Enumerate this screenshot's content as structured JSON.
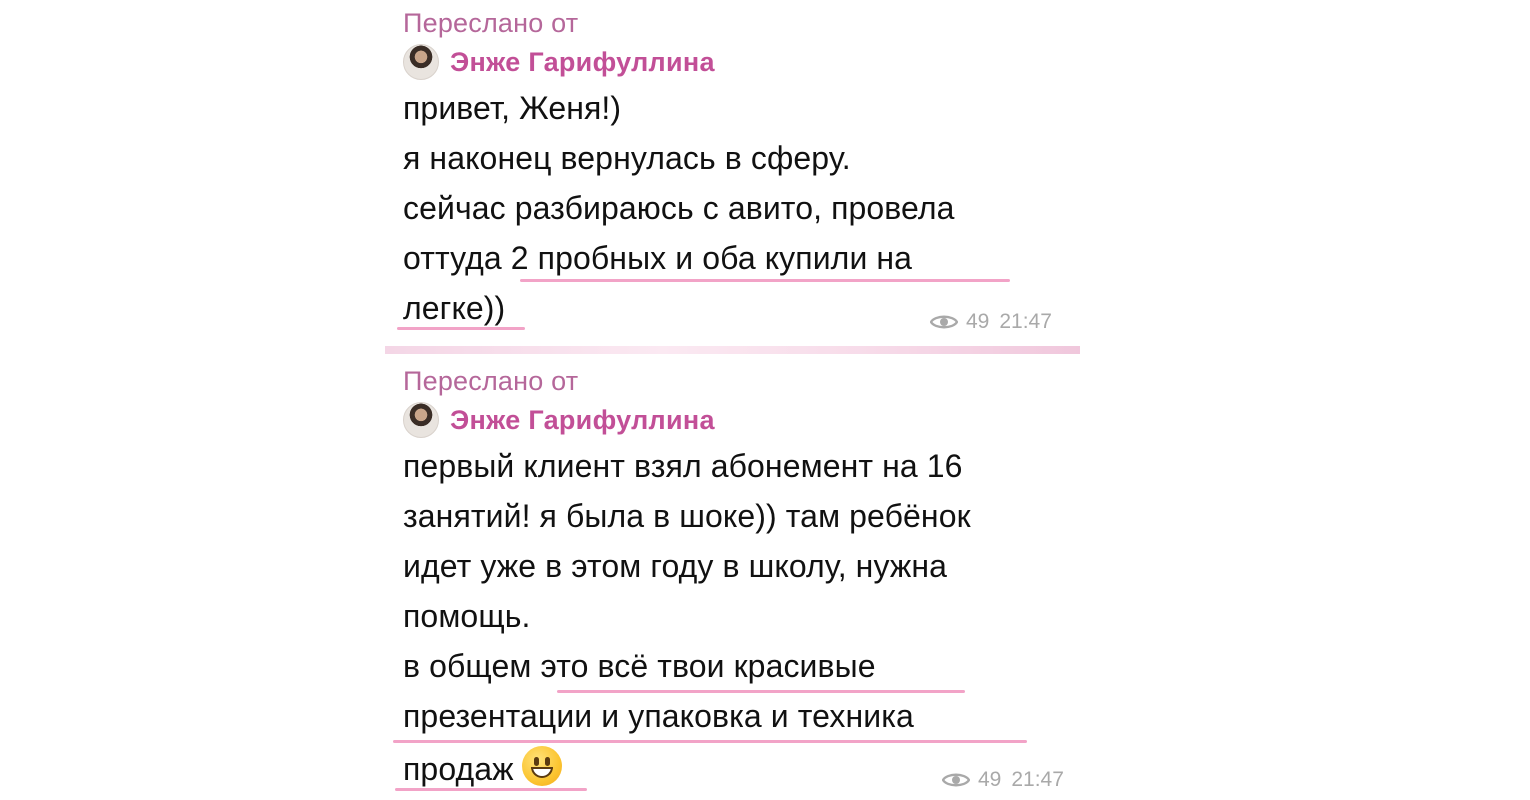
{
  "messages": [
    {
      "forwarded_label": "Переслано от",
      "sender": "Энже Гарифуллина",
      "lines": [
        "привет, Женя!)",
        "я наконец вернулась в сферу.",
        "сейчас разбираюсь с авито, провела",
        "оттуда 2 пробных и оба купили на",
        "легке))"
      ],
      "views": "49",
      "time": "21:47"
    },
    {
      "forwarded_label": "Переслано от",
      "sender": "Энже Гарифуллина",
      "lines": [
        "первый клиент взял абонемент на 16",
        "занятий! я была в шоке)) там ребёнок",
        "идет уже в этом году в школу, нужна",
        "помощь.",
        "в общем это всё твои красивые",
        "презентации и упаковка и техника",
        "продаж"
      ],
      "emoji": "grinning-face-emoji",
      "views": "49",
      "time": "21:47"
    }
  ],
  "colors": {
    "forwarded_label": "#b5679a",
    "sender": "#c24f97",
    "underline": "#f2a3c7",
    "meta": "#a9a9a9"
  }
}
